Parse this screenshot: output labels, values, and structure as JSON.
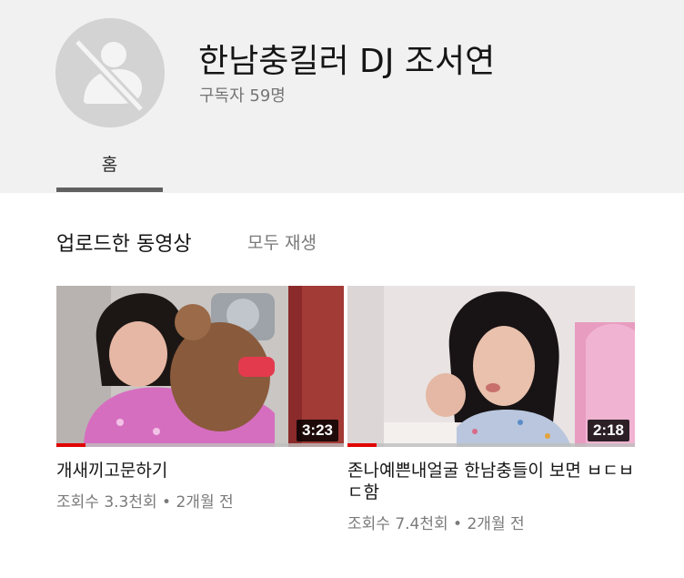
{
  "channel": {
    "name": "한남충킬러 DJ 조서연",
    "subscribers": "구독자 59명"
  },
  "tabs": [
    {
      "label": "홈",
      "active": true
    }
  ],
  "section": {
    "title": "업로드한 동영상",
    "play_all": "모두 재생"
  },
  "videos": [
    {
      "title": "개새끼고문하기",
      "duration": "3:23",
      "views": "조회수 3.3천회",
      "separator": "•",
      "age": "2개월 전",
      "progress": 0.1
    },
    {
      "title": "존나예쁜내얼굴 한남충들이 보면 ㅂㄷㅂㄷ함",
      "duration": "2:18",
      "views": "조회수 7.4천회",
      "separator": "•",
      "age": "2개월 전",
      "progress": 0.1
    }
  ],
  "colors": {
    "header_bg": "#f1f1f1",
    "progress": "#e00000",
    "muted_text": "#7a7a7a"
  },
  "icons": {
    "avatar": "default-avatar-slashed-icon"
  }
}
